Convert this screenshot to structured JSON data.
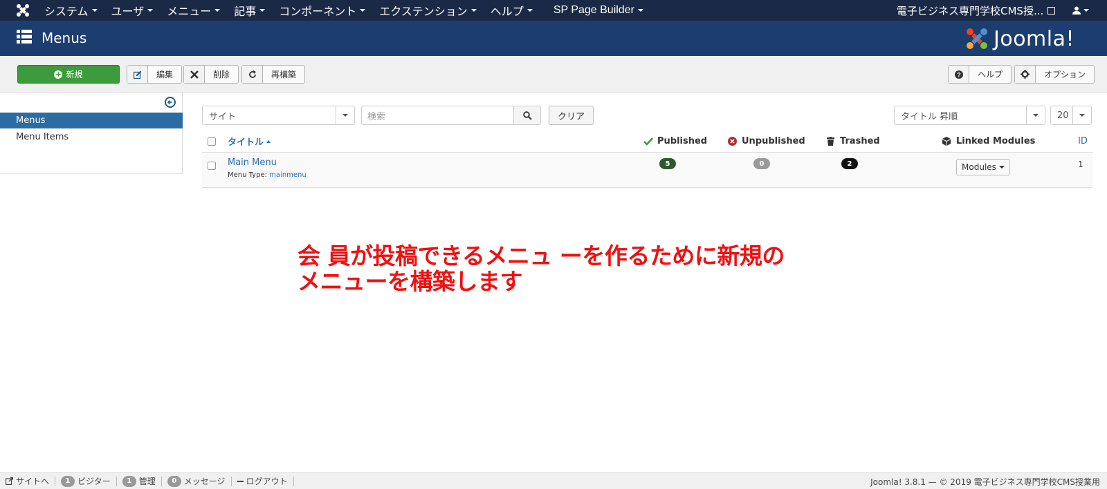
{
  "topbar": {
    "menus": [
      {
        "label": "システム"
      },
      {
        "label": "ユーザ"
      },
      {
        "label": "メニュー"
      },
      {
        "label": "記事"
      },
      {
        "label": "コンポーネント"
      },
      {
        "label": "エクステンション"
      },
      {
        "label": "ヘルプ"
      },
      {
        "label": "SP Page Builder"
      }
    ],
    "site_name": "電子ビジネス専門学校CMS授..."
  },
  "header": {
    "title": "Menus",
    "brand": "Joomla!"
  },
  "toolbar": {
    "new_label": "新規",
    "edit_label": "編集",
    "delete_label": "削除",
    "rebuild_label": "再構築",
    "help_label": "ヘルプ",
    "options_label": "オプション"
  },
  "sidebar": {
    "items": [
      {
        "label": "Menus",
        "active": true
      },
      {
        "label": "Menu Items",
        "active": false
      }
    ]
  },
  "filters": {
    "client": "サイト",
    "search_placeholder": "検索",
    "clear_label": "クリア",
    "ordering": "タイトル 昇順",
    "limit": "20"
  },
  "table": {
    "headers": {
      "title": "タイトル",
      "published": "Published",
      "unpublished": "Unpublished",
      "trashed": "Trashed",
      "linked_modules": "Linked Modules",
      "id": "ID"
    },
    "rows": [
      {
        "title": "Main Menu",
        "menu_type_label": "Menu Type:",
        "menu_type": "mainmenu",
        "published": "5",
        "unpublished": "0",
        "trashed": "2",
        "modules_label": "Modules",
        "id": "1"
      }
    ]
  },
  "annotation": {
    "line1": "会 員が投稿できるメニュ ーを作るために新規の",
    "line2": "メニューを構築します"
  },
  "statusbar": {
    "view_site": "サイトへ",
    "visitors_count": "1",
    "visitors_label": "ビジター",
    "admins_count": "1",
    "admins_label": "管理",
    "messages_count": "0",
    "messages_label": "メッセージ",
    "logout": "ログアウト",
    "footer": "Joomla! 3.8.1 — © 2019 電子ビジネス専門学校CMS授業用"
  },
  "colors": {
    "topbar": "#1a2a46",
    "header": "#1c3d6f",
    "new_button": "#3c9b3c",
    "sidebar_active": "#2d6ca2",
    "badge_published": "#2d5a2d",
    "badge_unpublished": "#999999",
    "badge_trashed": "#111111",
    "annotation": "#ee1111"
  }
}
